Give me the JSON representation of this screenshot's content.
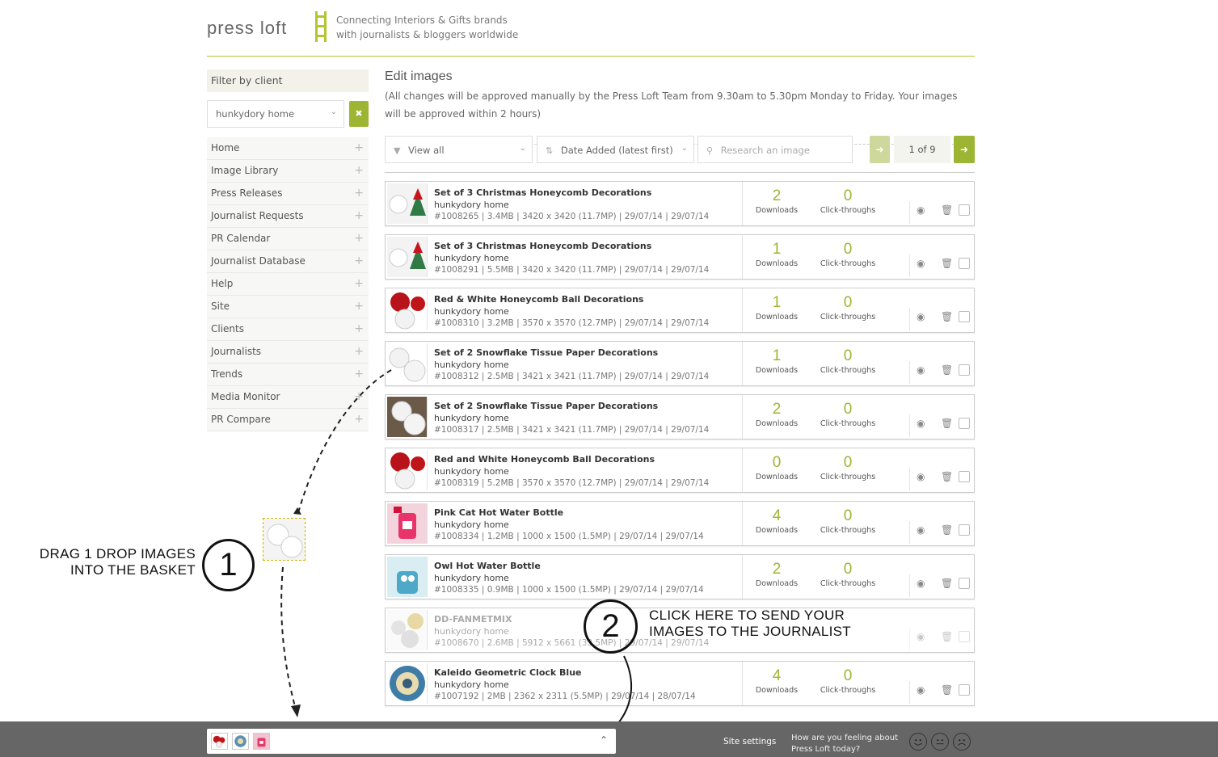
{
  "header": {
    "logo_text": "press loft",
    "tagline_1": "Connecting Interiors & Gifts brands",
    "tagline_2": "with journalists & bloggers worldwide"
  },
  "sidebar": {
    "filter_title": "Filter by client",
    "client_value": "hunkydory home",
    "items": [
      {
        "label": "Home"
      },
      {
        "label": "Image Library"
      },
      {
        "label": "Press Releases"
      },
      {
        "label": "Journalist Requests"
      },
      {
        "label": "PR Calendar"
      },
      {
        "label": "Journalist Database"
      },
      {
        "label": "Help"
      },
      {
        "label": "Site"
      },
      {
        "label": "Clients"
      },
      {
        "label": "Journalists"
      },
      {
        "label": "Trends"
      },
      {
        "label": "Media Monitor"
      },
      {
        "label": "PR Compare"
      }
    ]
  },
  "main": {
    "title": "Edit images",
    "note": "(All changes will be approved manually by the Press Loft Team from 9.30am to 5.30pm Monday to Friday. Your images will be approved within 2 hours)",
    "view_value": "View all",
    "sort_value": "Date Added (latest first)",
    "search_placeholder": "Research an image",
    "page_count": "1 of 9",
    "downloads_label": "Downloads",
    "clicks_label": "Click-throughs"
  },
  "rows": [
    {
      "title": "Set of 3 Christmas Honeycomb Decorations",
      "client": "hunkydory home",
      "meta": "#1008265 | 3.4MB | 3420 x 3420 (11.7MP) | 29/07/14 | 29/07/14",
      "downloads": "2",
      "clicks": "0",
      "thumb": "xmas"
    },
    {
      "title": "Set of 3 Christmas Honeycomb Decorations",
      "client": "hunkydory home",
      "meta": "#1008291 | 5.5MB | 3420 x 3420 (11.7MP) | 29/07/14 | 29/07/14",
      "downloads": "1",
      "clicks": "0",
      "thumb": "xmas"
    },
    {
      "title": "Red & White Honeycomb Ball Decorations",
      "client": "hunkydory home",
      "meta": "#1008310 | 3.2MB | 3570 x 3570 (12.7MP) | 29/07/14 | 29/07/14",
      "downloads": "1",
      "clicks": "0",
      "thumb": "red"
    },
    {
      "title": "Set of 2 Snowflake Tissue Paper Decorations",
      "client": "hunkydory home",
      "meta": "#1008312 | 2.5MB | 3421 x 3421 (11.7MP) | 29/07/14 | 29/07/14",
      "downloads": "1",
      "clicks": "0",
      "thumb": "snow"
    },
    {
      "title": "Set of 2 Snowflake Tissue Paper Decorations",
      "client": "hunkydory home",
      "meta": "#1008317 | 2.5MB | 3421 x 3421 (11.7MP) | 29/07/14 | 29/07/14",
      "downloads": "2",
      "clicks": "0",
      "thumb": "snow2"
    },
    {
      "title": "Red and White Honeycomb Ball Decorations",
      "client": "hunkydory home",
      "meta": "#1008319 | 5.2MB | 3570 x 3570 (12.7MP) | 29/07/14 | 29/07/14",
      "downloads": "0",
      "clicks": "0",
      "thumb": "red"
    },
    {
      "title": "Pink Cat Hot Water Bottle",
      "client": "hunkydory home",
      "meta": "#1008334 | 1.2MB | 1000 x 1500 (1.5MP) | 29/07/14 | 29/07/14",
      "downloads": "4",
      "clicks": "0",
      "thumb": "pink"
    },
    {
      "title": "Owl Hot Water Bottle",
      "client": "hunkydory home",
      "meta": "#1008335 | 0.9MB | 1000 x 1500 (1.5MP) | 29/07/14 | 29/07/14",
      "downloads": "2",
      "clicks": "0",
      "thumb": "owl"
    },
    {
      "title": "DD-FANMETMIX",
      "client": "hunkydory home",
      "meta": "#1008670 | 2.6MB | 5912 x 5661 (33.5MP) | 29/07/14 | 29/07/14",
      "downloads": "",
      "clicks": "",
      "thumb": "fan",
      "disabled": true
    },
    {
      "title": "Kaleido Geometric Clock Blue",
      "client": "hunkydory home",
      "meta": "#1007192 | 2MB | 2362 x 2311 (5.5MP) | 29/07/14 | 28/07/14",
      "downloads": "4",
      "clicks": "0",
      "thumb": "clock"
    }
  ],
  "footer": {
    "site_settings": "Site settings",
    "feeling_q": "How are you feeling about Press Loft today?"
  },
  "annotations": {
    "step1_num": "1",
    "step1_line1": "DRAG 1 DROP IMAGES",
    "step1_line2": "INTO THE BASKET",
    "step2_num": "2",
    "step2_line1": "CLICK HERE TO SEND YOUR",
    "step2_line2": "IMAGES TO THE JOURNALIST"
  },
  "colors": {
    "accent": "#9cb532",
    "footer": "#666666"
  }
}
